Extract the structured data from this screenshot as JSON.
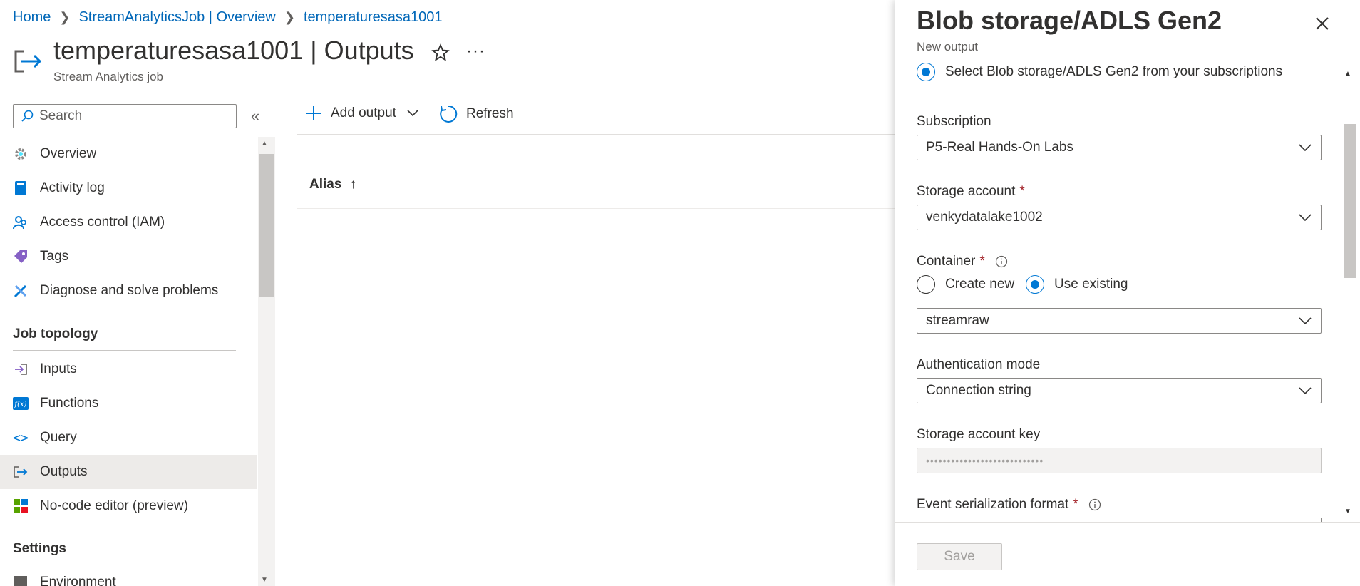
{
  "breadcrumb": [
    "Home",
    "StreamAnalyticsJob | Overview",
    "temperaturesasa1001"
  ],
  "header": {
    "title": "temperaturesasa1001 | Outputs",
    "subtitle": "Stream Analytics job",
    "more": "···"
  },
  "search": {
    "placeholder": "Search"
  },
  "sidebar": {
    "items_top": [
      {
        "label": "Overview",
        "icon": "overview-gear-icon"
      },
      {
        "label": "Activity log",
        "icon": "activity-log-icon"
      },
      {
        "label": "Access control (IAM)",
        "icon": "people-icon"
      },
      {
        "label": "Tags",
        "icon": "tag-icon"
      },
      {
        "label": "Diagnose and solve problems",
        "icon": "wrench-icon"
      }
    ],
    "section_job_topology": "Job topology",
    "items_topology": [
      {
        "label": "Inputs",
        "icon": "inputs-icon"
      },
      {
        "label": "Functions",
        "icon": "functions-icon"
      },
      {
        "label": "Query",
        "icon": "query-icon"
      },
      {
        "label": "Outputs",
        "icon": "outputs-icon",
        "active": true
      },
      {
        "label": "No-code editor (preview)",
        "icon": "no-code-editor-icon"
      }
    ],
    "section_settings": "Settings",
    "items_settings": [
      {
        "label": "Environment",
        "icon": "environment-icon"
      }
    ]
  },
  "toolbar": {
    "add_output": "Add output",
    "refresh": "Refresh"
  },
  "table": {
    "column_alias": "Alias",
    "sort_arrow": "↑"
  },
  "blade": {
    "title": "Blob storage/ADLS Gen2",
    "subtitle": "New output",
    "select_option": "Select Blob storage/ADLS Gen2 from your subscriptions",
    "subscription_label": "Subscription",
    "subscription_value": "P5-Real Hands-On Labs",
    "storage_account_label": "Storage account",
    "storage_account_value": "venkydatalake1002",
    "container_label": "Container",
    "container_create_new": "Create new",
    "container_use_existing": "Use existing",
    "container_mode_selected": "Use existing",
    "container_value": "streamraw",
    "auth_mode_label": "Authentication mode",
    "auth_mode_value": "Connection string",
    "storage_key_label": "Storage account key",
    "storage_key_value": "••••••••••••••••••••••••••••",
    "serialization_label": "Event serialization format",
    "required_mark": "*",
    "save_label": "Save"
  },
  "colors": {
    "accent": "#0078d4",
    "link": "#0067b8",
    "required": "#a4262c"
  }
}
